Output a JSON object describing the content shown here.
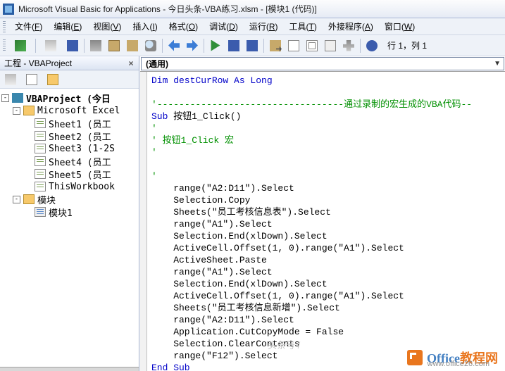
{
  "title": "Microsoft Visual Basic for Applications - 今日头条-VBA练习.xlsm - [模块1 (代码)]",
  "menu": {
    "file": {
      "label": "文件",
      "key": "F"
    },
    "edit": {
      "label": "编辑",
      "key": "E"
    },
    "view": {
      "label": "视图",
      "key": "V"
    },
    "insert": {
      "label": "插入",
      "key": "I"
    },
    "format": {
      "label": "格式",
      "key": "O"
    },
    "debug": {
      "label": "调试",
      "key": "D"
    },
    "run": {
      "label": "运行",
      "key": "R"
    },
    "tools": {
      "label": "工具",
      "key": "T"
    },
    "addins": {
      "label": "外接程序",
      "key": "A"
    },
    "window": {
      "label": "窗口",
      "key": "W"
    }
  },
  "toolbar": {
    "status": "行 1，列 1"
  },
  "project_explorer": {
    "title": "工程 - VBAProject",
    "tree": [
      {
        "depth": 0,
        "toggle": "-",
        "icon": "proj",
        "label": "VBAProject (今日"
      },
      {
        "depth": 1,
        "toggle": "-",
        "icon": "folder",
        "label": "Microsoft Excel"
      },
      {
        "depth": 2,
        "toggle": "",
        "icon": "sheet",
        "label": "Sheet1 (员工"
      },
      {
        "depth": 2,
        "toggle": "",
        "icon": "sheet",
        "label": "Sheet2 (员工"
      },
      {
        "depth": 2,
        "toggle": "",
        "icon": "sheet",
        "label": "Sheet3 (1-2S"
      },
      {
        "depth": 2,
        "toggle": "",
        "icon": "sheet",
        "label": "Sheet4 (员工"
      },
      {
        "depth": 2,
        "toggle": "",
        "icon": "sheet",
        "label": "Sheet5 (员工"
      },
      {
        "depth": 2,
        "toggle": "",
        "icon": "sheet",
        "label": "ThisWorkbook"
      },
      {
        "depth": 1,
        "toggle": "-",
        "icon": "folder",
        "label": "模块"
      },
      {
        "depth": 2,
        "toggle": "",
        "icon": "module",
        "label": "模块1"
      }
    ]
  },
  "code_dropdown": {
    "left": "(通用)"
  },
  "code": {
    "l1": "Dim destCurRow As Long",
    "l2": "",
    "l3a": "'",
    "l3b": "通过录制的宏生成的VBA代码",
    "l4a": "Sub ",
    "l4b": "按钮1_Click()",
    "l5": "'",
    "l6": "' 按钮1_Click 宏",
    "l7": "'",
    "l8": "",
    "l9": "'",
    "i10": "    range(\"A2:D11\").Select",
    "i11": "    Selection.Copy",
    "i12": "    Sheets(\"员工考核信息表\").Select",
    "i13": "    range(\"A1\").Select",
    "i14": "    Selection.End(xlDown).Select",
    "i15": "    ActiveCell.Offset(1, 0).range(\"A1\").Select",
    "i16": "    ActiveSheet.Paste",
    "i17": "    range(\"A1\").Select",
    "i18": "    Selection.End(xlDown).Select",
    "i19": "    ActiveCell.Offset(1, 0).range(\"A1\").Select",
    "i20": "    Sheets(\"员工考核信息新增\").Select",
    "i21": "    range(\"A2:D11\").Select",
    "i22": "    Application.CutCopyMode = False",
    "i23": "    Selection.ClearContents",
    "i24": "    range(\"F12\").Select",
    "l25": "End Sub"
  },
  "watermark": {
    "brand_a": "Office",
    "brand_b": "教程网",
    "url": "www.office26.com",
    "toutiao": "头条号 /"
  }
}
